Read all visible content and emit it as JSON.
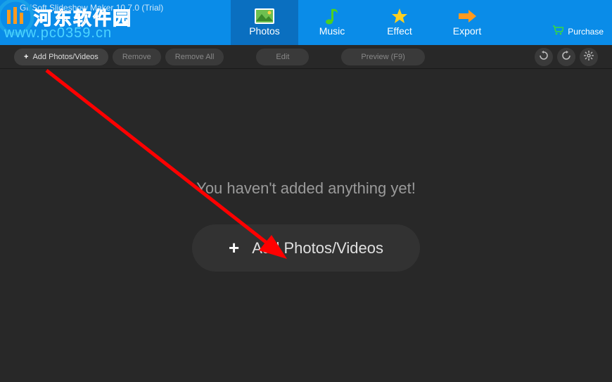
{
  "app": {
    "title": "GiliSoft Slideshow Maker 10.7.0 (Trial)"
  },
  "watermark": {
    "chinese": "河东软件园",
    "url": "www.pc0359.cn"
  },
  "tabs": {
    "photos": "Photos",
    "music": "Music",
    "effect": "Effect",
    "export": "Export"
  },
  "purchase": {
    "label": "Purchase"
  },
  "toolbar": {
    "add": "Add Photos/Videos",
    "remove": "Remove",
    "remove_all": "Remove All",
    "edit": "Edit",
    "preview": "Preview (F9)"
  },
  "main": {
    "empty_message": "You haven't added anything yet!",
    "add_button": "Add Photos/Videos"
  }
}
